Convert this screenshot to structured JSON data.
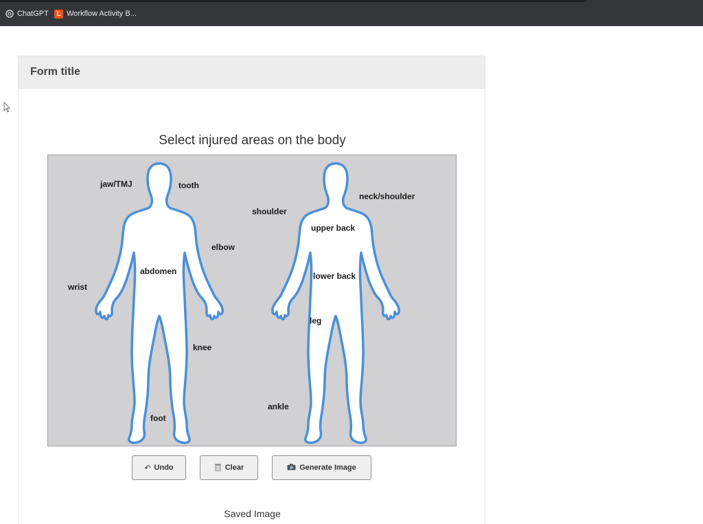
{
  "bookmarks": [
    {
      "label": "ChatGPT",
      "icon": "chatgpt-icon"
    },
    {
      "label": "Workflow Activity B...",
      "icon": "l-letter-icon",
      "icon_text": "L"
    }
  ],
  "form": {
    "title": "Form title",
    "section_title": "Select injured areas on the body",
    "body_parts_front": [
      "jaw/TMJ",
      "tooth",
      "elbow",
      "wrist",
      "abdomen",
      "knee",
      "foot"
    ],
    "body_parts_back": [
      "shoulder",
      "neck/shoulder",
      "upper back",
      "lower back",
      "leg",
      "ankle"
    ],
    "buttons": {
      "undo": "Undo",
      "clear": "Clear",
      "generate": "Generate Image"
    },
    "saved_image_label": "Saved Image"
  },
  "colors": {
    "bookmarks_bar": "#35363a",
    "canvas_bg": "#d1d0d2",
    "figure_outline": "#4a90d9",
    "figure_fill": "#ffffff"
  }
}
